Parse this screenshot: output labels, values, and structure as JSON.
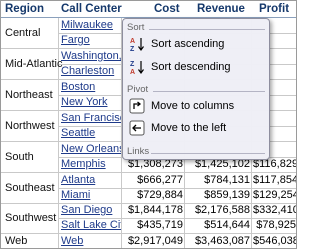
{
  "table": {
    "headers": [
      "Region",
      "Call Center",
      "Cost",
      "Revenue",
      "Profit"
    ],
    "regions": [
      {
        "name": "Central",
        "centers": [
          "Milwaukee",
          "Fargo"
        ]
      },
      {
        "name": "Mid-Atlantic",
        "centers": [
          "Washington,",
          "Charleston"
        ]
      },
      {
        "name": "Northeast",
        "centers": [
          "Boston",
          "New York"
        ]
      },
      {
        "name": "Northwest",
        "centers": [
          "San Francisc",
          "Seattle"
        ]
      },
      {
        "name": "South",
        "centers": [
          "New Orleans",
          "Memphis"
        ]
      },
      {
        "name": "Southeast",
        "centers": [
          "Atlanta",
          "Miami"
        ]
      },
      {
        "name": "Southwest",
        "centers": [
          "San Diego",
          "Salt Lake City"
        ]
      },
      {
        "name": "Web",
        "centers": [
          "Web"
        ]
      }
    ],
    "rows": [
      {
        "cost": "",
        "revenue": "",
        "profit": ""
      },
      {
        "cost": "",
        "revenue": "",
        "profit": ""
      },
      {
        "cost": "",
        "revenue": "",
        "profit": ""
      },
      {
        "cost": "",
        "revenue": "",
        "profit": ""
      },
      {
        "cost": "",
        "revenue": "",
        "profit": ""
      },
      {
        "cost": "",
        "revenue": "",
        "profit": ""
      },
      {
        "cost": "",
        "revenue": "",
        "profit": ""
      },
      {
        "cost": "",
        "revenue": "",
        "profit": ""
      },
      {
        "cost": "",
        "revenue": "",
        "profit": ""
      },
      {
        "cost": "$1,308,273",
        "revenue": "$1,425,102",
        "profit": "$116,829"
      },
      {
        "cost": "$666,277",
        "revenue": "$784,131",
        "profit": "$117,854"
      },
      {
        "cost": "$729,884",
        "revenue": "$859,139",
        "profit": "$129,254"
      },
      {
        "cost": "$1,844,178",
        "revenue": "$2,176,588",
        "profit": "$332,410"
      },
      {
        "cost": "$435,719",
        "revenue": "$514,644",
        "profit": "$78,925"
      },
      {
        "cost": "$2,917,049",
        "revenue": "$3,463,087",
        "profit": "$546,038"
      }
    ]
  },
  "menu": {
    "sections": {
      "sort": "Sort",
      "pivot": "Pivot",
      "links": "Links"
    },
    "items": {
      "sort_ascending": "Sort ascending",
      "sort_descending": "Sort descending",
      "move_to_columns": "Move to columns",
      "move_to_left": "Move to the left"
    }
  },
  "colors": {
    "header_text": "#15386b",
    "link_text": "#1e3a8a",
    "menu_bg": "#eeeef6"
  },
  "icons": {
    "sort_ascending": "sort-az-icon",
    "sort_descending": "sort-za-icon",
    "move_to_columns": "pivot-columns-icon",
    "move_to_left": "move-left-icon"
  }
}
